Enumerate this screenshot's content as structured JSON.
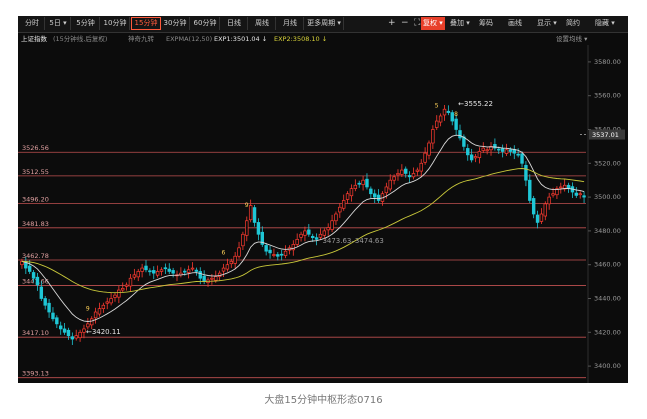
{
  "toolbar": {
    "left": [
      {
        "label": "分时",
        "w": 24
      },
      {
        "label": "5日 ▾",
        "w": 24
      },
      {
        "label": "5分钟",
        "w": 27
      },
      {
        "label": "10分钟",
        "w": 28
      },
      {
        "label": "15分钟",
        "w": 28,
        "active": true
      },
      {
        "label": "30分钟",
        "w": 28
      },
      {
        "label": "60分钟",
        "w": 28
      },
      {
        "label": "日线",
        "w": 26
      },
      {
        "label": "周线",
        "w": 26
      },
      {
        "label": "月线",
        "w": 26
      },
      {
        "label": "更多周期 ▾",
        "w": 38
      }
    ],
    "icons": [
      "+",
      "−",
      "⛶"
    ],
    "right": [
      {
        "label": "复权 ▾",
        "red": true
      },
      {
        "label": "叠加 ▾"
      },
      {
        "label": "筹码"
      },
      {
        "label": "画线"
      },
      {
        "label": "显示 ▾"
      },
      {
        "label": "简约"
      },
      {
        "label": "隐藏 ▾"
      }
    ]
  },
  "info": {
    "name": "上证指数",
    "period": "(15分钟线,后复权)",
    "indicator": "神奇九转",
    "expma": "EXPMA(12,50)",
    "exp1": "EXP1:3501.04 ↓",
    "exp2": "EXP2:3508.10 ↓",
    "settings": "设置均线 ▾"
  },
  "colors": {
    "up": "#ff3b30",
    "down": "#1fc7d6",
    "exp1": "#d9d9d9",
    "exp2": "#c9c83a",
    "level": "#c05050",
    "current": "#3a3a3a",
    "nine": "#ffd25a"
  },
  "chart_data": {
    "type": "candlestick",
    "y_axis": {
      "min": 3390,
      "max": 3590,
      "ticks": [
        3580,
        3560,
        3540,
        3520,
        3500,
        3480,
        3460,
        3440,
        3420,
        3400
      ],
      "tick_labels": [
        "3580.00",
        "3560.00",
        "3540.00",
        "3520.00",
        "3500.00",
        "3480.00",
        "3460.00",
        "3440.00",
        "3420.00",
        "3400.00"
      ]
    },
    "current_price": "3537.01",
    "levels": [
      {
        "value": 3526.56,
        "label": "3526.56"
      },
      {
        "value": 3512.55,
        "label": "3512.55"
      },
      {
        "value": 3496.2,
        "label": "3496.20"
      },
      {
        "value": 3481.83,
        "label": "3481.83"
      },
      {
        "value": 3462.78,
        "label": "3462.78"
      },
      {
        "value": 3447.66,
        "label": "3447.66"
      },
      {
        "value": 3417.1,
        "label": "3417.10"
      },
      {
        "value": 3393.13,
        "label": "3393.13"
      }
    ],
    "annotations": [
      {
        "text": "←3555.22",
        "index": 112,
        "value": 3555.22
      },
      {
        "text": "←3420.11",
        "index": 16,
        "value": 3420.11
      },
      {
        "text": "3473.63–3474.63",
        "index": 77,
        "value": 3474.1
      }
    ],
    "closes": [
      3462,
      3458,
      3456,
      3452,
      3448,
      3440,
      3436,
      3432,
      3428,
      3425,
      3422,
      3420,
      3418,
      3416,
      3418,
      3420,
      3422,
      3425,
      3428,
      3432,
      3434,
      3436,
      3438,
      3440,
      3442,
      3445,
      3446,
      3448,
      3452,
      3454,
      3456,
      3458,
      3457,
      3456,
      3455,
      3456,
      3457,
      3458,
      3456,
      3455,
      3454,
      3455,
      3456,
      3457,
      3458,
      3456,
      3452,
      3450,
      3451,
      3452,
      3453,
      3455,
      3458,
      3460,
      3462,
      3465,
      3470,
      3478,
      3486,
      3495,
      3485,
      3478,
      3472,
      3468,
      3467,
      3466,
      3465,
      3466,
      3468,
      3470,
      3472,
      3475,
      3478,
      3480,
      3478,
      3476,
      3475,
      3478,
      3480,
      3482,
      3486,
      3490,
      3494,
      3498,
      3502,
      3505,
      3507,
      3508,
      3510,
      3506,
      3502,
      3500,
      3498,
      3502,
      3506,
      3510,
      3512,
      3514,
      3516,
      3514,
      3512,
      3514,
      3516,
      3520,
      3526,
      3532,
      3540,
      3545,
      3548,
      3552,
      3550,
      3545,
      3540,
      3535,
      3530,
      3525,
      3522,
      3524,
      3527,
      3529,
      3528,
      3530,
      3529,
      3528,
      3527,
      3528,
      3527,
      3526,
      3525,
      3520,
      3510,
      3498,
      3490,
      3485,
      3490,
      3496,
      3500,
      3502,
      3505,
      3506,
      3507,
      3505,
      3503,
      3501,
      3502,
      3500
    ]
  },
  "caption": "大盘15分钟中枢形态0716"
}
